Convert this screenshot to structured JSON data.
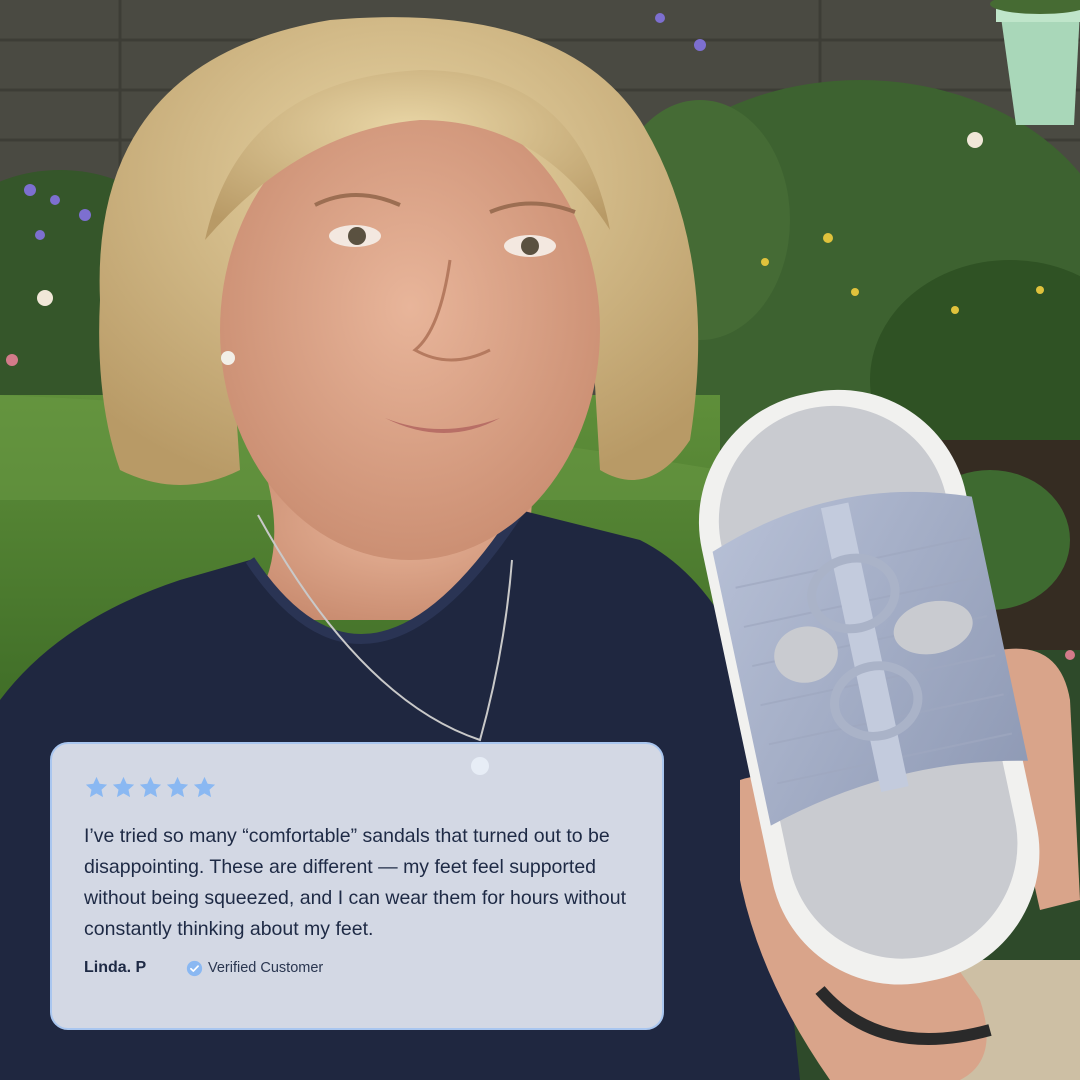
{
  "review": {
    "rating": 5,
    "rating_max": 5,
    "text": "I’ve tried so many “comfortable” sandals that turned out to be disappointing. These are different — my feet feel supported without being squeezed, and I can wear them for hours without constantly thinking about my feet.",
    "author": "Linda. P",
    "verified_label": "Verified Customer"
  },
  "colors": {
    "star": "#8ab8f2",
    "verified_badge": "#8ab8f2",
    "card_border": "#a9c6ef",
    "text": "#1e2a45"
  },
  "icons": {
    "star": "star-icon",
    "verified": "check-badge-icon"
  }
}
